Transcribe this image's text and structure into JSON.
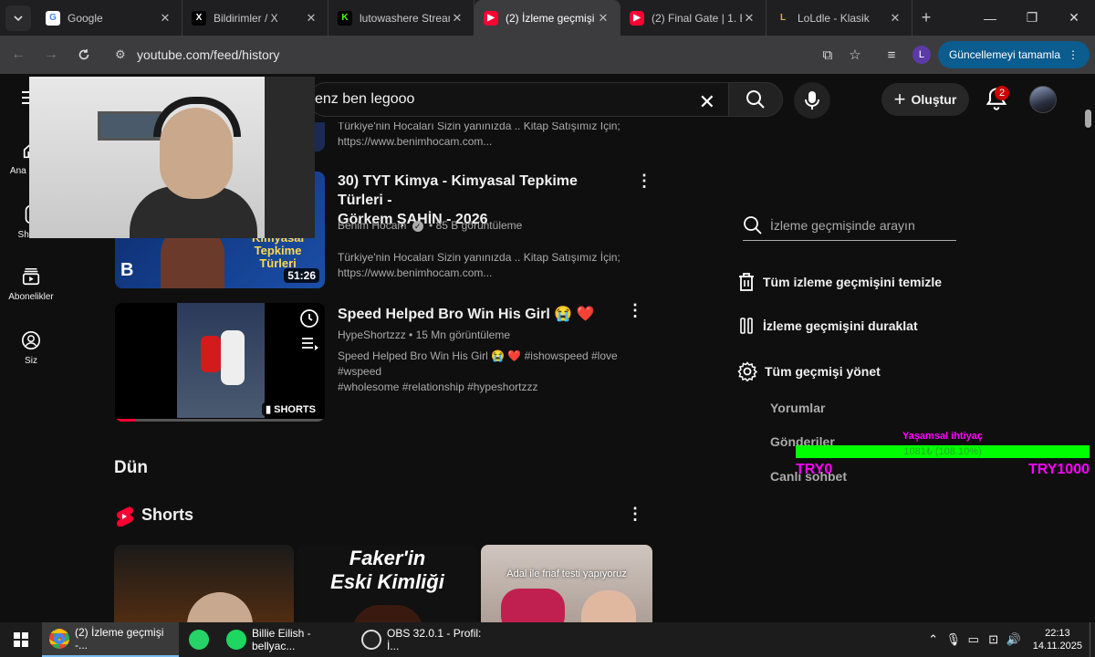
{
  "browser": {
    "tabs": [
      {
        "title": "Google",
        "icon": "google-icon"
      },
      {
        "title": "Bildirimler / X",
        "icon": "x-icon"
      },
      {
        "title": "lutowashere Stream",
        "icon": "kick-icon"
      },
      {
        "title": "(2) İzleme geçmişi",
        "icon": "youtube-icon",
        "active": true
      },
      {
        "title": "(2) Final Gate | 1. B",
        "icon": "youtube-icon"
      },
      {
        "title": "LoLdle - Klasik",
        "icon": "loldle-icon"
      }
    ],
    "url": "youtube.com/feed/history",
    "profile_initial": "L",
    "update_label": "Güncellemeyi tamamla"
  },
  "sidebar": {
    "items": [
      {
        "label": "Ana Sayfa",
        "icon": "home-icon"
      },
      {
        "label": "Shorts",
        "icon": "shorts-icon"
      },
      {
        "label": "Abonelikler",
        "icon": "subscriptions-icon"
      },
      {
        "label": "Siz",
        "icon": "you-icon"
      }
    ]
  },
  "topbar": {
    "search_value": "enz ben legooo",
    "create_label": "Oluştur",
    "notification_count": "2"
  },
  "feed": {
    "videos": [
      {
        "desc1": "Türkiye'nin Hocaları Sizin yanınızda .. Kitap Satışımız İçin;",
        "desc2": "https://www.benimhocam.com..."
      },
      {
        "title1": "30) TYT Kimya - Kimyasal Tepkime Türleri -",
        "title2": "Görkem ŞAHİN - 2026",
        "channel": "Benim Hocam",
        "views": "85 B görüntüleme",
        "desc1": "Türkiye'nin Hocaları Sizin yanınızda .. Kitap Satışımız İçin;",
        "desc2": "https://www.benimhocam.com...",
        "duration": "51:26",
        "thumb_text1": "Kimyasal",
        "thumb_text2": "Tepkime",
        "thumb_text3": "Türleri"
      },
      {
        "title": "Speed Helped Bro Win His Girl 😭 ❤️",
        "channel": "HypeShortzzz",
        "views": "15 Mn görüntüleme",
        "desc1": "Speed Helped Bro Win His Girl 😭 ❤️ #ishowspeed #love #wspeed",
        "desc2": "#wholesome #relationship #hypeshortzzz",
        "badge": "SHORTS"
      }
    ],
    "section_yesterday": "Dün",
    "shorts_heading": "Shorts",
    "shorts": [
      {
        "overlay": ""
      },
      {
        "overlay1": "Faker'in",
        "overlay2": "Eski Kimliği"
      },
      {
        "overlay": "Adal ile fnaf testi yapıyoruz"
      }
    ]
  },
  "right_panel": {
    "search_placeholder": "İzleme geçmişinde arayın",
    "clear_all": "Tüm izleme geçmişini temizle",
    "pause": "İzleme geçmişini duraklat",
    "manage": "Tüm geçmişi yönet",
    "sub_items": [
      "Yorumlar",
      "Gönderiler",
      "Canlı sohbet"
    ]
  },
  "stream_overlay": {
    "goal_title": "Yaşamsal ihtiyaç",
    "goal_percent_text": "1081₺ (108.10%)",
    "goal_progress": 1.081,
    "min_label": "TRY0",
    "max_label": "TRY1000"
  },
  "taskbar": {
    "apps": [
      {
        "label": "(2) İzleme geçmişi -...",
        "icon": "chrome-icon",
        "active": true
      },
      {
        "label": "",
        "icon": "whatsapp-icon"
      },
      {
        "label": "Billie Eilish - bellyac...",
        "icon": "spotify-icon"
      },
      {
        "label": "OBS 32.0.1 - Profil: İ...",
        "icon": "obs-icon"
      }
    ],
    "time": "22:13",
    "date": "14.11.2025"
  },
  "colors": {
    "youtube_red": "#ff0033",
    "goal_green": "#00ff00",
    "goal_magenta": "#ff00ff",
    "update_blue": "#0b5c8f"
  }
}
